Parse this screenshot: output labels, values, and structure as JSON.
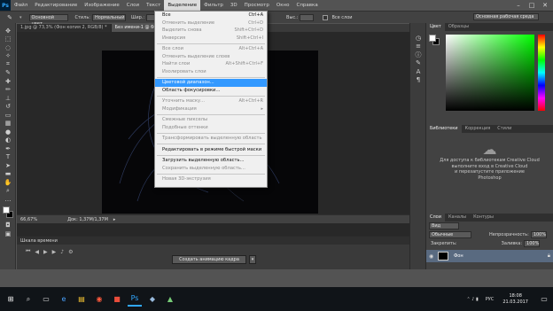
{
  "app": {
    "logo": "Ps",
    "menu": [
      "Файл",
      "Редактирование",
      "Изображение",
      "Слои",
      "Текст",
      "Выделение",
      "Фильтр",
      "3D",
      "Просмотр",
      "Окно",
      "Справка"
    ],
    "active_menu_index": 5,
    "window_controls": {
      "minimize": "–",
      "maximize": "□",
      "close": "✕"
    }
  },
  "options_bar": {
    "sample": "Основной цвет",
    "mode_label": "Стиль:",
    "mode": "Нормальный",
    "width_label": "Шир.:",
    "height_label": "Выс.:",
    "all_layers": "Все слои",
    "workspace": "Основная рабочая среда"
  },
  "tabs": [
    {
      "label": "1.jpg @ 73,3% (Фон копия 2, RGB/8) *",
      "active": false
    },
    {
      "label": "Без имени-1 @ 66,7% (RGB/8) *",
      "active": true
    }
  ],
  "status": {
    "zoom": "66,67%",
    "doc": "Док: 1,37M/1,37M"
  },
  "timeline": {
    "title": "Шкала времени",
    "create_button": "Создать анимацию кадра"
  },
  "selection_menu": {
    "items": [
      {
        "label": "Все",
        "shortcut": "Ctrl+A",
        "disabled": false
      },
      {
        "label": "Отменить выделение",
        "shortcut": "Ctrl+D",
        "disabled": true
      },
      {
        "label": "Выделить снова",
        "shortcut": "Shift+Ctrl+D",
        "disabled": true
      },
      {
        "label": "Инверсия",
        "shortcut": "Shift+Ctrl+I",
        "disabled": true
      },
      {
        "sep": true
      },
      {
        "label": "Все слои",
        "shortcut": "Alt+Ctrl+A",
        "disabled": true
      },
      {
        "label": "Отменить выделение слоев",
        "shortcut": "",
        "disabled": true
      },
      {
        "label": "Найти слои",
        "shortcut": "Alt+Shift+Ctrl+F",
        "disabled": true
      },
      {
        "label": "Изолировать слои",
        "shortcut": "",
        "disabled": true
      },
      {
        "sep": true
      },
      {
        "label": "Цветовой диапазон...",
        "shortcut": "",
        "disabled": false,
        "highlight": true
      },
      {
        "label": "Область фокусировки...",
        "shortcut": "",
        "disabled": false
      },
      {
        "sep": true
      },
      {
        "label": "Уточнить маску...",
        "shortcut": "Alt+Ctrl+R",
        "disabled": true
      },
      {
        "label": "Модификация",
        "shortcut": "▸",
        "disabled": true
      },
      {
        "sep": true
      },
      {
        "label": "Смежные пикселы",
        "shortcut": "",
        "disabled": true
      },
      {
        "label": "Подобные оттенки",
        "shortcut": "",
        "disabled": true
      },
      {
        "sep": true
      },
      {
        "label": "Трансформировать выделенную область",
        "shortcut": "",
        "disabled": true
      },
      {
        "sep": true
      },
      {
        "label": "Редактировать в режиме быстрой маски",
        "shortcut": "",
        "disabled": false
      },
      {
        "sep": true
      },
      {
        "label": "Загрузить выделенную область...",
        "shortcut": "",
        "disabled": false
      },
      {
        "label": "Сохранить выделенную область...",
        "shortcut": "",
        "disabled": true
      },
      {
        "sep": true
      },
      {
        "label": "Новая 3D-экструзия",
        "shortcut": "",
        "disabled": true
      }
    ]
  },
  "panels": {
    "color_tabs": [
      "Цвет",
      "Образцы"
    ],
    "library_tabs": [
      "Библиотеки",
      "Коррекция",
      "Стили"
    ],
    "cc_text": [
      "Для доступа к библиотекам Creative Cloud",
      "выполните вход в Creative Cloud",
      "и перезапустите приложение",
      "Photoshop"
    ],
    "layers_tabs": [
      "Слои",
      "Каналы",
      "Контуры"
    ],
    "kind": "Вид",
    "blend": "Обычные",
    "opacity_label": "Непрозрачность:",
    "opacity": "100%",
    "lock_label": "Закрепить:",
    "fill_label": "Заливка:",
    "fill": "100%",
    "layer_name": "Фон",
    "swatch_fg": "#ffffff",
    "swatch_bg": "#000000"
  },
  "taskbar": {
    "lang": "РУС",
    "time": "18:08",
    "date": "21.03.2017"
  }
}
